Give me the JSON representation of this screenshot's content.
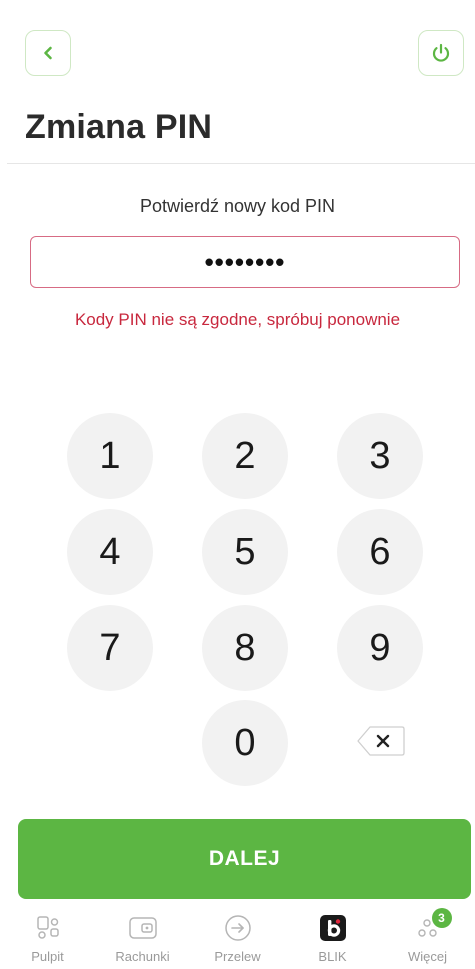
{
  "header": {
    "title": "Zmiana PIN",
    "back_icon": "chevron-left-icon",
    "power_icon": "power-icon",
    "accent_color": "#5cb643"
  },
  "pin": {
    "prompt": "Potwierdź nowy kod PIN",
    "masked_value": "••••••••",
    "error": "Kody PIN nie są zgodne, spróbuj ponownie",
    "error_color": "#c8283e"
  },
  "keypad": {
    "keys": [
      "1",
      "2",
      "3",
      "4",
      "5",
      "6",
      "7",
      "8",
      "9",
      "0"
    ],
    "backspace_icon": "backspace-icon"
  },
  "action": {
    "label": "DALEJ"
  },
  "tabbar": {
    "items": [
      {
        "label": "Pulpit",
        "icon": "dashboard-icon"
      },
      {
        "label": "Rachunki",
        "icon": "wallet-icon"
      },
      {
        "label": "Przelew",
        "icon": "transfer-arrow-icon"
      },
      {
        "label": "BLIK",
        "icon": "blik-icon"
      },
      {
        "label": "Więcej",
        "icon": "more-dots-icon",
        "badge": "3"
      }
    ]
  }
}
